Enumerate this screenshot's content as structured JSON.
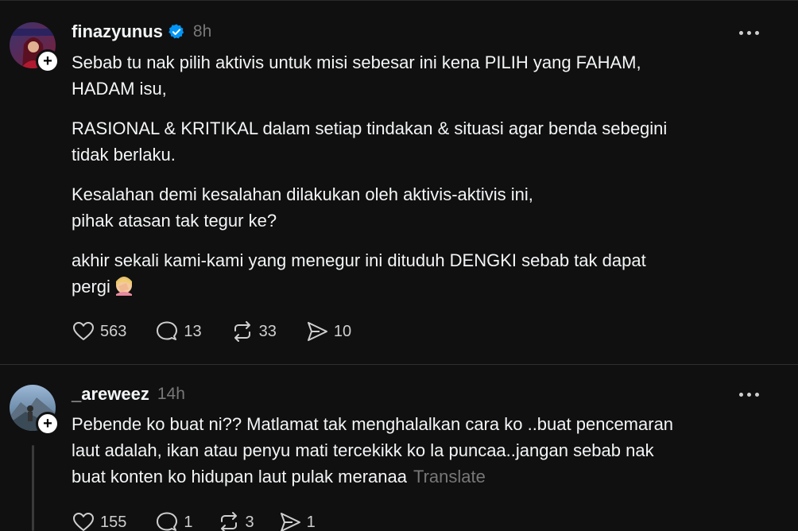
{
  "posts": [
    {
      "username": "finazyunus",
      "time": "8h",
      "verified": true,
      "paragraphs": [
        "Sebab tu nak pilih aktivis untuk misi sebesar ini kena PILIH yang FAHAM,\nHADAM isu,",
        "RASIONAL & KRITIKAL dalam setiap tindakan & situasi agar benda sebegini\ntidak berlaku.",
        "Kesalahan demi kesalahan dilakukan oleh aktivis-aktivis ini,\npihak atasan tak tegur ke?",
        "akhir sekali kami-kami yang menegur ini dituduh DENGKI sebab tak dapat\npergi"
      ],
      "emoji": "🤦‍♀️",
      "likes": "563",
      "comments": "13",
      "reposts": "33",
      "shares": "10"
    },
    {
      "username": "_areweez",
      "time": "14h",
      "verified": false,
      "paragraphs": [
        "Pebende ko buat ni?? Matlamat tak menghalalkan cara ko ..buat pencemaran\nlaut adalah, ikan atau penyu mati tercekikk ko la puncaa..jangan sebab nak\nbuat konten ko hidupan laut pulak meranaa"
      ],
      "translate_label": "Translate",
      "likes": "155",
      "comments": "1",
      "reposts": "3",
      "shares": "1"
    }
  ],
  "colors": {
    "background": "#101010",
    "text": "#f3f5f7",
    "muted": "#777777",
    "verified": "#0095f6"
  },
  "icons": [
    "heart-icon",
    "comment-icon",
    "repost-icon",
    "share-icon",
    "more-icon",
    "verified-icon",
    "follow-plus-icon"
  ]
}
